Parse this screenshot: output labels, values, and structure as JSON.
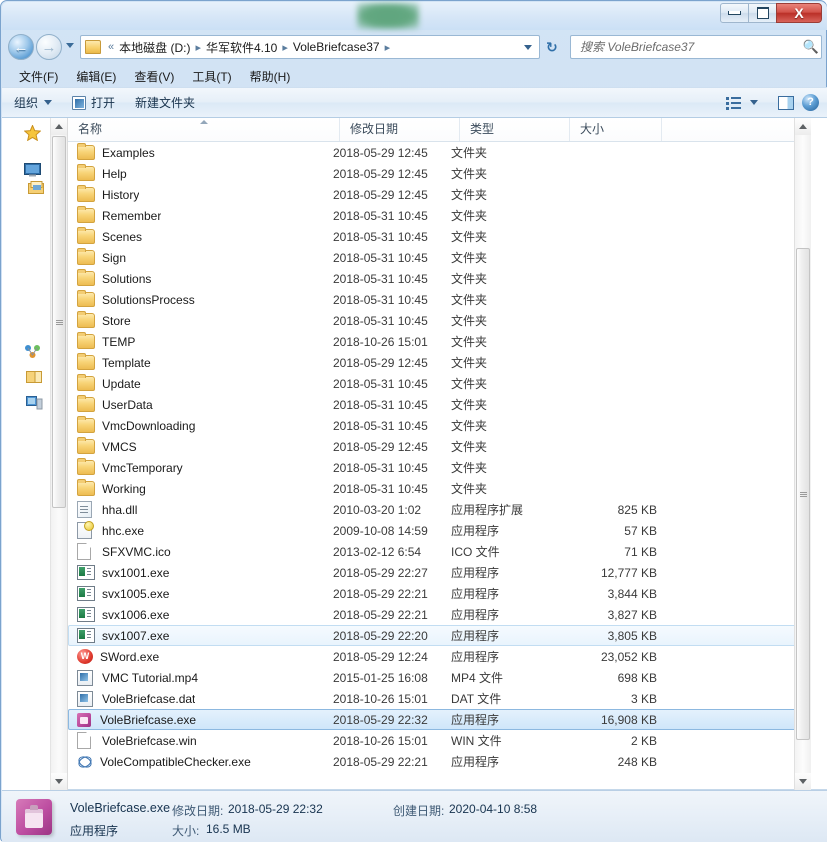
{
  "window": {
    "caption_buttons": {
      "minimize": "minimize-button",
      "maximize": "maximize-button",
      "close_label": "X"
    }
  },
  "navigation": {
    "back_glyph": "←",
    "forward_glyph": "→",
    "refresh_glyph": "↻",
    "address": {
      "prefix": "«",
      "crumbs": [
        "本地磁盘 (D:)",
        "华军软件4.10",
        "VoleBriefcase37"
      ],
      "separator": "▸"
    },
    "search": {
      "placeholder": "搜索 VoleBriefcase37",
      "value": ""
    }
  },
  "menubar": {
    "items": [
      "文件(F)",
      "编辑(E)",
      "查看(V)",
      "工具(T)",
      "帮助(H)"
    ]
  },
  "commandbar": {
    "organize": "组织",
    "open": "打开",
    "new_folder": "新建文件夹",
    "help_glyph": "?"
  },
  "filelist": {
    "columns": [
      {
        "key": "name",
        "label": "名称"
      },
      {
        "key": "date",
        "label": "修改日期"
      },
      {
        "key": "type",
        "label": "类型"
      },
      {
        "key": "size",
        "label": "大小"
      }
    ],
    "sort_column": "名称",
    "sort_direction": "ascending",
    "rows": [
      {
        "icon": "folder-icon",
        "name": "Examples",
        "date": "2018-05-29 12:45",
        "type": "文件夹",
        "size": "",
        "state": "normal"
      },
      {
        "icon": "folder-icon",
        "name": "Help",
        "date": "2018-05-29 12:45",
        "type": "文件夹",
        "size": "",
        "state": "normal"
      },
      {
        "icon": "folder-icon",
        "name": "History",
        "date": "2018-05-29 12:45",
        "type": "文件夹",
        "size": "",
        "state": "normal"
      },
      {
        "icon": "folder-icon",
        "name": "Remember",
        "date": "2018-05-31 10:45",
        "type": "文件夹",
        "size": "",
        "state": "normal"
      },
      {
        "icon": "folder-icon",
        "name": "Scenes",
        "date": "2018-05-31 10:45",
        "type": "文件夹",
        "size": "",
        "state": "normal"
      },
      {
        "icon": "folder-icon",
        "name": "Sign",
        "date": "2018-05-31 10:45",
        "type": "文件夹",
        "size": "",
        "state": "normal"
      },
      {
        "icon": "folder-icon",
        "name": "Solutions",
        "date": "2018-05-31 10:45",
        "type": "文件夹",
        "size": "",
        "state": "normal"
      },
      {
        "icon": "folder-icon",
        "name": "SolutionsProcess",
        "date": "2018-05-31 10:45",
        "type": "文件夹",
        "size": "",
        "state": "normal"
      },
      {
        "icon": "folder-icon",
        "name": "Store",
        "date": "2018-05-31 10:45",
        "type": "文件夹",
        "size": "",
        "state": "normal"
      },
      {
        "icon": "folder-icon",
        "name": "TEMP",
        "date": "2018-10-26 15:01",
        "type": "文件夹",
        "size": "",
        "state": "normal"
      },
      {
        "icon": "folder-icon",
        "name": "Template",
        "date": "2018-05-29 12:45",
        "type": "文件夹",
        "size": "",
        "state": "normal"
      },
      {
        "icon": "folder-icon",
        "name": "Update",
        "date": "2018-05-31 10:45",
        "type": "文件夹",
        "size": "",
        "state": "normal"
      },
      {
        "icon": "folder-icon",
        "name": "UserData",
        "date": "2018-05-31 10:45",
        "type": "文件夹",
        "size": "",
        "state": "normal"
      },
      {
        "icon": "folder-icon",
        "name": "VmcDownloading",
        "date": "2018-05-31 10:45",
        "type": "文件夹",
        "size": "",
        "state": "normal"
      },
      {
        "icon": "folder-icon",
        "name": "VMCS",
        "date": "2018-05-29 12:45",
        "type": "文件夹",
        "size": "",
        "state": "normal"
      },
      {
        "icon": "folder-icon",
        "name": "VmcTemporary",
        "date": "2018-05-31 10:45",
        "type": "文件夹",
        "size": "",
        "state": "normal"
      },
      {
        "icon": "folder-icon",
        "name": "Working",
        "date": "2018-05-31 10:45",
        "type": "文件夹",
        "size": "",
        "state": "normal"
      },
      {
        "icon": "dll-icon",
        "name": "hha.dll",
        "date": "2010-03-20 1:02",
        "type": "应用程序扩展",
        "size": "825 KB",
        "state": "normal"
      },
      {
        "icon": "hhc-icon",
        "name": "hhc.exe",
        "date": "2009-10-08 14:59",
        "type": "应用程序",
        "size": "57 KB",
        "state": "normal"
      },
      {
        "icon": "document-icon",
        "name": "SFXVMC.ico",
        "date": "2013-02-12 6:54",
        "type": "ICO 文件",
        "size": "71 KB",
        "state": "normal"
      },
      {
        "icon": "exe-icon",
        "name": "svx1001.exe",
        "date": "2018-05-29 22:27",
        "type": "应用程序",
        "size": "12,777 KB",
        "state": "normal"
      },
      {
        "icon": "exe-icon",
        "name": "svx1005.exe",
        "date": "2018-05-29 22:21",
        "type": "应用程序",
        "size": "3,844 KB",
        "state": "normal"
      },
      {
        "icon": "exe-icon",
        "name": "svx1006.exe",
        "date": "2018-05-29 22:21",
        "type": "应用程序",
        "size": "3,827 KB",
        "state": "normal"
      },
      {
        "icon": "exe-icon",
        "name": "svx1007.exe",
        "date": "2018-05-29 22:20",
        "type": "应用程序",
        "size": "3,805 KB",
        "state": "hover"
      },
      {
        "icon": "sword-icon",
        "name": "SWord.exe",
        "date": "2018-05-29 12:24",
        "type": "应用程序",
        "size": "23,052 KB",
        "state": "normal"
      },
      {
        "icon": "mp4-icon",
        "name": "VMC Tutorial.mp4",
        "date": "2015-01-25 16:08",
        "type": "MP4 文件",
        "size": "698 KB",
        "state": "normal"
      },
      {
        "icon": "dat-icon",
        "name": "VoleBriefcase.dat",
        "date": "2018-10-26 15:01",
        "type": "DAT 文件",
        "size": "3 KB",
        "state": "normal"
      },
      {
        "icon": "vole-icon",
        "name": "VoleBriefcase.exe",
        "date": "2018-05-29 22:32",
        "type": "应用程序",
        "size": "16,908 KB",
        "state": "selected"
      },
      {
        "icon": "document-icon",
        "name": "VoleBriefcase.win",
        "date": "2018-10-26 15:01",
        "type": "WIN 文件",
        "size": "2 KB",
        "state": "normal"
      },
      {
        "icon": "atom-icon",
        "name": "VoleCompatibleChecker.exe",
        "date": "2018-05-29 22:21",
        "type": "应用程序",
        "size": "248 KB",
        "state": "normal"
      }
    ]
  },
  "details": {
    "filename": "VoleBriefcase.exe",
    "modified_label": "修改日期:",
    "modified_value": "2018-05-29 22:32",
    "created_label": "创建日期:",
    "created_value": "2020-04-10 8:58",
    "type": "应用程序",
    "size_label": "大小:",
    "size_value": "16.5 MB"
  },
  "colors": {
    "selection": "#cfe6fa",
    "selection_border": "#8cb8e0",
    "accent": "#2a7dc4",
    "close_button": "#ba3028"
  }
}
